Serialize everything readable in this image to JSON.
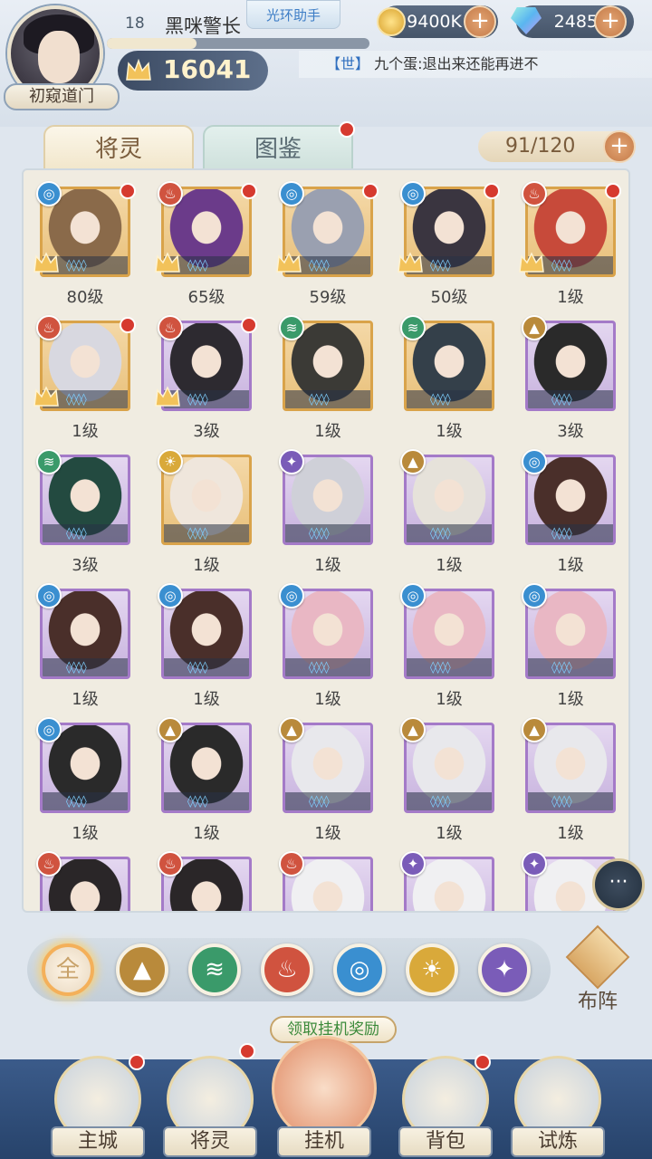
{
  "header": {
    "level": "18",
    "player_name": "黑咪警长",
    "helper_label": "光环助手",
    "title_badge": "初窥道门",
    "power": "16041",
    "xp_fraction": 0.34,
    "coins": "9400K",
    "gems": "2485",
    "chat_channel": "【世】",
    "chat_message": "九个蛋:退出来还能再进不"
  },
  "tabs": {
    "spirits": "将灵",
    "codex": "图鉴",
    "capacity": "91/120"
  },
  "cards": [
    {
      "element": "water",
      "frame": "gold",
      "level": "80级",
      "crown": true,
      "dot": true
    },
    {
      "element": "fire",
      "frame": "gold",
      "level": "65级",
      "crown": true,
      "dot": true
    },
    {
      "element": "water",
      "frame": "gold",
      "level": "59级",
      "crown": true,
      "dot": true
    },
    {
      "element": "water",
      "frame": "gold",
      "level": "50级",
      "crown": true,
      "dot": true
    },
    {
      "element": "fire",
      "frame": "gold",
      "level": "1级",
      "crown": true,
      "dot": true
    },
    {
      "element": "fire",
      "frame": "gold",
      "level": "1级",
      "crown": true,
      "dot": true
    },
    {
      "element": "fire",
      "frame": "purple",
      "level": "3级",
      "crown": true,
      "dot": true
    },
    {
      "element": "wind",
      "frame": "gold",
      "level": "1级",
      "crown": false,
      "dot": false
    },
    {
      "element": "wind",
      "frame": "gold",
      "level": "1级",
      "crown": false,
      "dot": false
    },
    {
      "element": "earth",
      "frame": "purple",
      "level": "3级",
      "crown": false,
      "dot": false
    },
    {
      "element": "wind",
      "frame": "purple",
      "level": "3级",
      "crown": false,
      "dot": false
    },
    {
      "element": "light",
      "frame": "gold",
      "level": "1级",
      "crown": false,
      "dot": false
    },
    {
      "element": "dark",
      "frame": "purple",
      "level": "1级",
      "crown": false,
      "dot": false
    },
    {
      "element": "earth",
      "frame": "purple",
      "level": "1级",
      "crown": false,
      "dot": false
    },
    {
      "element": "water",
      "frame": "purple",
      "level": "1级",
      "crown": false,
      "dot": false
    },
    {
      "element": "water",
      "frame": "purple",
      "level": "1级",
      "crown": false,
      "dot": false
    },
    {
      "element": "water",
      "frame": "purple",
      "level": "1级",
      "crown": false,
      "dot": false
    },
    {
      "element": "water",
      "frame": "purple",
      "level": "1级",
      "crown": false,
      "dot": false
    },
    {
      "element": "water",
      "frame": "purple",
      "level": "1级",
      "crown": false,
      "dot": false
    },
    {
      "element": "water",
      "frame": "purple",
      "level": "1级",
      "crown": false,
      "dot": false
    },
    {
      "element": "water",
      "frame": "purple",
      "level": "1级",
      "crown": false,
      "dot": false
    },
    {
      "element": "earth",
      "frame": "purple",
      "level": "1级",
      "crown": false,
      "dot": false
    },
    {
      "element": "earth",
      "frame": "purple",
      "level": "1级",
      "crown": false,
      "dot": false
    },
    {
      "element": "earth",
      "frame": "purple",
      "level": "1级",
      "crown": false,
      "dot": false
    },
    {
      "element": "earth",
      "frame": "purple",
      "level": "1级",
      "crown": false,
      "dot": false
    },
    {
      "element": "fire",
      "frame": "purple",
      "level": "",
      "crown": false,
      "dot": false
    },
    {
      "element": "fire",
      "frame": "purple",
      "level": "",
      "crown": false,
      "dot": false
    },
    {
      "element": "fire",
      "frame": "purple",
      "level": "",
      "crown": false,
      "dot": false
    },
    {
      "element": "dark",
      "frame": "purple",
      "level": "",
      "crown": false,
      "dot": false
    },
    {
      "element": "dark",
      "frame": "purple",
      "level": "",
      "crown": false,
      "dot": false
    }
  ],
  "filters": {
    "all": "全"
  },
  "formation_label": "布阵",
  "reward_label": "领取挂机奖励",
  "nav": {
    "city": "主城",
    "spirits": "将灵",
    "idle": "挂机",
    "bag": "背包",
    "trial": "试炼"
  }
}
